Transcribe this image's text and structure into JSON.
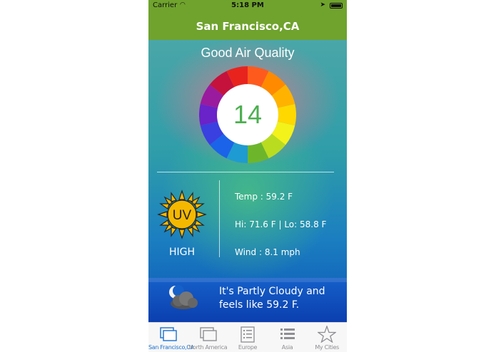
{
  "status_bar": {
    "carrier": "Carrier",
    "time": "5:18 PM"
  },
  "nav": {
    "title": "San Francisco,CA"
  },
  "air_quality": {
    "label": "Good Air Quality",
    "value": "14"
  },
  "uv": {
    "icon_text": "UV",
    "level": "HIGH"
  },
  "weather": {
    "temp": "Temp : 59.2 F",
    "hi_lo": "Hi: 71.6 F | Lo: 58.8 F",
    "wind": "Wind : 8.1 mph",
    "summary": "It's Partly Cloudy and feels like 59.2 F."
  },
  "tabs": [
    {
      "label": "San Francisco,CA",
      "icon": "cards-icon",
      "active": true
    },
    {
      "label": "North America",
      "icon": "cards-icon",
      "active": false
    },
    {
      "label": "Europe",
      "icon": "list-doc-icon",
      "active": false
    },
    {
      "label": "Asia",
      "icon": "list-icon",
      "active": false
    },
    {
      "label": "My Cities",
      "icon": "star-icon",
      "active": false
    }
  ],
  "colors": {
    "nav_bar": "#6fa32d",
    "aqi_number": "#4caf50",
    "tab_active": "#1a6fd0",
    "tab_inactive": "#8e8e93",
    "uv_sun": "#f5b800"
  }
}
